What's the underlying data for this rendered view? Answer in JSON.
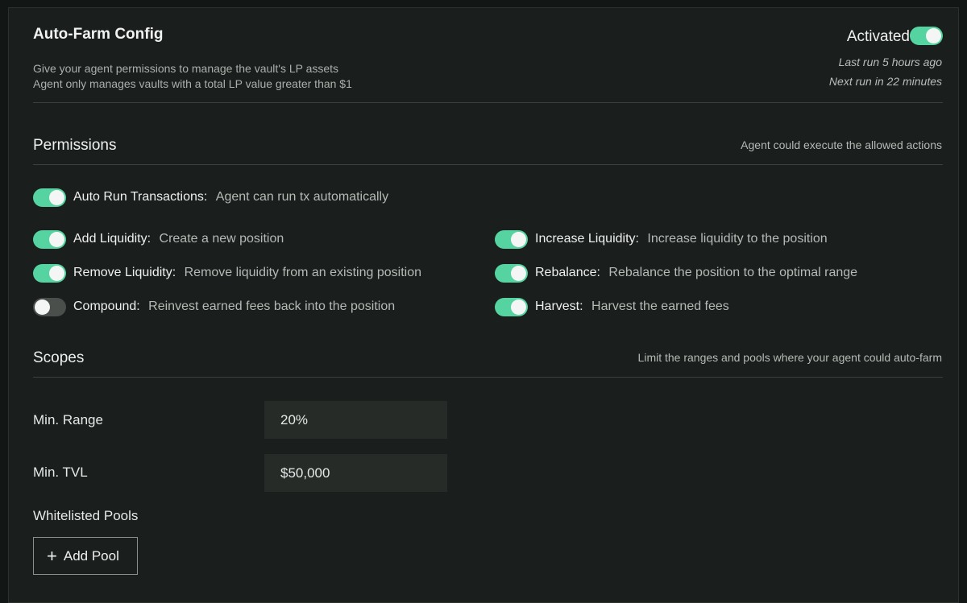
{
  "config": {
    "title": "Auto-Farm Config",
    "description_1": "Give your agent permissions to manage the vault's LP assets",
    "description_2": "Agent only manages vaults with a total LP value greater than $1",
    "status_label": "Activated",
    "status_on": true,
    "last_run": "Last run 5 hours ago",
    "next_run": "Next run in 22 minutes"
  },
  "permissions": {
    "title": "Permissions",
    "note": "Agent could execute the allowed actions",
    "auto_run": {
      "name": "Auto Run Transactions:",
      "desc": "Agent can run tx automatically",
      "on": true
    },
    "items": [
      {
        "name": "Add Liquidity:",
        "desc": "Create a new position",
        "on": true
      },
      {
        "name": "Increase Liquidity:",
        "desc": "Increase liquidity to the position",
        "on": true
      },
      {
        "name": "Remove Liquidity:",
        "desc": "Remove liquidity from an existing position",
        "on": true
      },
      {
        "name": "Rebalance:",
        "desc": "Rebalance the position to the optimal range",
        "on": true
      },
      {
        "name": "Compound:",
        "desc": "Reinvest earned fees back into the position",
        "on": false
      },
      {
        "name": "Harvest:",
        "desc": "Harvest the earned fees",
        "on": true
      }
    ]
  },
  "scopes": {
    "title": "Scopes",
    "note": "Limit the ranges and pools where your agent could auto-farm",
    "min_range_label": "Min. Range",
    "min_range_value": "20%",
    "min_tvl_label": "Min. TVL",
    "min_tvl_value": "$50,000",
    "whitelist_label": "Whitelisted Pools",
    "add_pool_label": "Add Pool"
  },
  "colors": {
    "accent": "#55d3a0",
    "panel": "#1a1e1c",
    "background": "#121614"
  }
}
